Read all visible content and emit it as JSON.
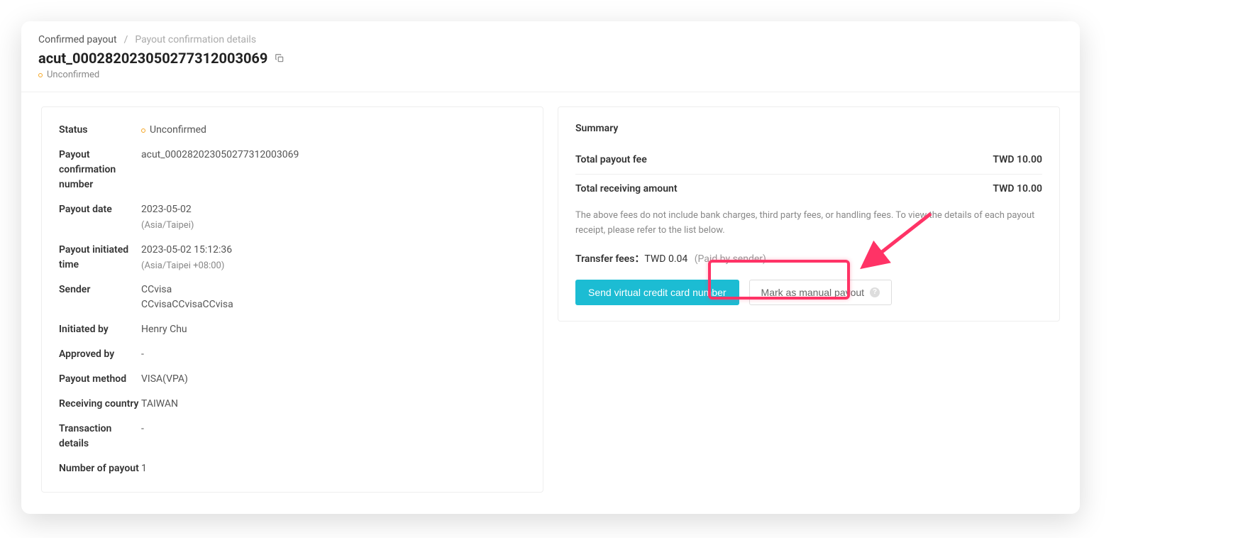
{
  "breadcrumb": {
    "parent": "Confirmed payout",
    "current": "Payout confirmation details"
  },
  "page_title": "acut_000282023050277312003069",
  "status_badge": "Unconfirmed",
  "details": {
    "status_label": "Status",
    "status_value": "Unconfirmed",
    "confirmation_number_label": "Payout confirmation number",
    "confirmation_number_value": "acut_000282023050277312003069",
    "payout_date_label": "Payout date",
    "payout_date_value": "2023-05-02",
    "payout_date_tz": "(Asia/Taipei)",
    "initiated_time_label": "Payout initiated time",
    "initiated_time_value": "2023-05-02 15:12:36",
    "initiated_time_tz": "(Asia/Taipei +08:00)",
    "sender_label": "Sender",
    "sender_value1": "CCvisa",
    "sender_value2": "CCvisaCCvisaCCvisa",
    "initiated_by_label": "Initiated by",
    "initiated_by_value": "Henry Chu",
    "approved_by_label": "Approved by",
    "approved_by_value": "-",
    "payout_method_label": "Payout method",
    "payout_method_value": "VISA(VPA)",
    "receiving_country_label": "Receiving country",
    "receiving_country_value": "TAIWAN",
    "transaction_details_label": "Transaction details",
    "transaction_details_value": "-",
    "number_of_payout_label": "Number of payout",
    "number_of_payout_value": "1"
  },
  "summary": {
    "title": "Summary",
    "total_payout_fee_label": "Total payout fee",
    "total_payout_fee_value": "TWD 10.00",
    "total_receiving_label": "Total receiving amount",
    "total_receiving_value": "TWD 10.00",
    "note": "The above fees do not include bank charges, third party fees, or handling fees. To view the details of each payout receipt, please refer to the list below.",
    "transfer_fees_label": "Transfer fees：",
    "transfer_fees_value": "TWD 0.04",
    "transfer_fees_paid": "(Paid by sender)",
    "btn_send": "Send virtual credit card number",
    "btn_manual": "Mark as manual payout"
  }
}
